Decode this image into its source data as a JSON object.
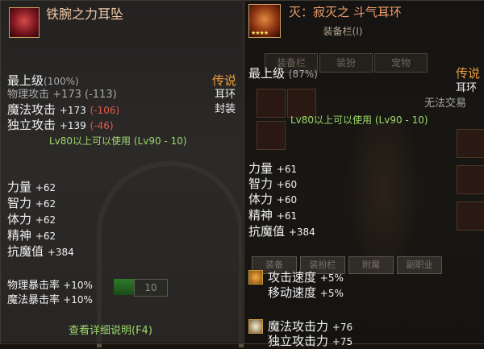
{
  "left_tooltip": {
    "item_name": "铁腕之力耳坠",
    "grade": "最上级",
    "grade_pct": "(100%)",
    "rarity": "传说",
    "slot": "耳环",
    "bind": "封装",
    "stats_attack": [
      {
        "label": "物理攻击",
        "value": "+173",
        "diff": "(-113)"
      },
      {
        "label": "魔法攻击",
        "value": "+173",
        "diff": "(-106)"
      },
      {
        "label": "独立攻击",
        "value": "+139",
        "diff": "(-46)"
      }
    ],
    "level_req": "Lv80以上可以使用 (Lv90 - 10)",
    "stats_attr": [
      {
        "label": "力量",
        "value": "+62"
      },
      {
        "label": "智力",
        "value": "+62"
      },
      {
        "label": "体力",
        "value": "+62"
      },
      {
        "label": "精神",
        "value": "+62"
      },
      {
        "label": "抗魔值",
        "value": "+384"
      }
    ],
    "crit": [
      {
        "label": "物理暴击率",
        "value": "+10%"
      },
      {
        "label": "魔法暴击率",
        "value": "+10%"
      }
    ],
    "details_link": "查看详细说明(F4)",
    "number_box": "10"
  },
  "right_tooltip": {
    "item_name": "灭：寂灭之 斗气耳环",
    "panel_header": "装备栏(I)",
    "tabs": [
      "装备栏",
      "装扮",
      "宠物"
    ],
    "grade": "最上级",
    "grade_pct": "(87%)",
    "rarity": "传说",
    "slot": "耳环",
    "trade": "无法交易",
    "level_req": "Lv80以上可以使用 (Lv90 - 10)",
    "stats_attr": [
      {
        "label": "力量",
        "value": "+61"
      },
      {
        "label": "智力",
        "value": "+60"
      },
      {
        "label": "体力",
        "value": "+60"
      },
      {
        "label": "精神",
        "value": "+61"
      },
      {
        "label": "抗魔值",
        "value": "+384"
      }
    ],
    "buttons": [
      "装备",
      "装扮栏",
      "附魔",
      "副职业"
    ],
    "speed": [
      {
        "label": "攻击速度",
        "value": "+5%"
      },
      {
        "label": "移动速度",
        "value": "+5%"
      }
    ],
    "magic_atk": {
      "label": "魔法攻击力",
      "value": "+76"
    },
    "indep_atk": {
      "label": "独立攻击力",
      "value": "+75"
    }
  }
}
